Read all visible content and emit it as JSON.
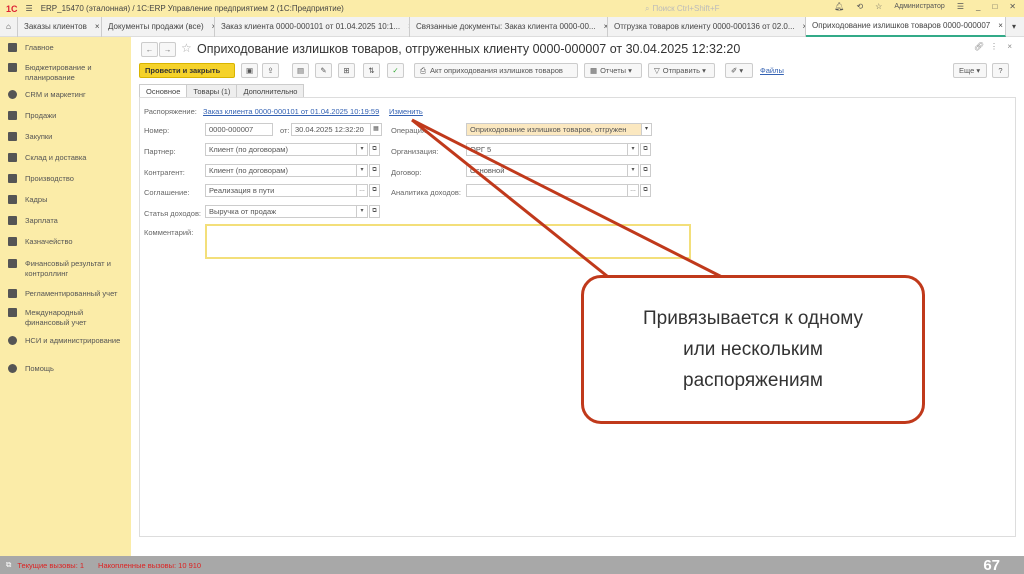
{
  "titlebar": {
    "logo": "1С",
    "title": "ERP_15470 (эталонная) / 1С:ERP Управление предприятием 2  (1С:Предприятие)",
    "search_placeholder": "Поиск Ctrl+Shift+F",
    "user": "Администратор"
  },
  "tabs": [
    {
      "label": "Заказы клиентов"
    },
    {
      "label": "Документы продажи (все)"
    },
    {
      "label": "Заказ клиента 0000-000101 от 01.04.2025 10:1..."
    },
    {
      "label": "Связанные документы: Заказ клиента 0000-00..."
    },
    {
      "label": "Отгрузка товаров клиенту 0000-000136 от 02.0..."
    },
    {
      "label": "Оприходование излишков товаров   0000-000007"
    }
  ],
  "sidebar": {
    "items": [
      {
        "label": "Главное"
      },
      {
        "label": "Бюджетирование и планирование"
      },
      {
        "label": "CRM и маркетинг"
      },
      {
        "label": "Продажи"
      },
      {
        "label": "Закупки"
      },
      {
        "label": "Склад и доставка"
      },
      {
        "label": "Производство"
      },
      {
        "label": "Кадры"
      },
      {
        "label": "Зарплата"
      },
      {
        "label": "Казначейство"
      },
      {
        "label": "Финансовый результат и контроллинг"
      },
      {
        "label": "Регламентированный учет"
      },
      {
        "label": "Международный финансовый учет"
      },
      {
        "label": "НСИ и администрирование"
      },
      {
        "label": "Помощь"
      }
    ]
  },
  "document": {
    "title": "Оприходование излишков товаров, отгруженных клиенту 0000-000007 от 30.04.2025 12:32:20"
  },
  "toolbar": {
    "post_close": "Провести и закрыть",
    "act": "Акт оприходования излишков товаров",
    "reports": "Отчеты",
    "send": "Отправить",
    "files": "Файлы",
    "more": "Еще",
    "help": "?"
  },
  "form_tabs": [
    {
      "label": "Основное"
    },
    {
      "label": "Товары (1)"
    },
    {
      "label": "Дополнительно"
    }
  ],
  "form": {
    "order_label": "Распоряжение:",
    "order_link": "Заказ клиента 0000-000101 от 01.04.2025 10:19:59",
    "change_link": "Изменить",
    "number_label": "Номер:",
    "number": "0000-000007",
    "date_label": "от:",
    "date": "30.04.2025 12:32:20",
    "partner_label": "Партнер:",
    "partner": "Клиент (по договорам)",
    "counterparty_label": "Контрагент:",
    "counterparty": "Клиент (по договорам)",
    "agreement_label": "Соглашение:",
    "agreement": "Реализация в пути",
    "income_item_label": "Статья доходов:",
    "income_item": "Выручка от продаж",
    "comment_label": "Комментарий:",
    "comment": "",
    "operation_label": "Операция:",
    "operation": "Оприходование излишков товаров, отгружен",
    "organization_label": "Организация:",
    "organization": "ОРГ 5",
    "contract_label": "Договор:",
    "contract": "Основной",
    "income_analytics_label": "Аналитика доходов:",
    "income_analytics": ""
  },
  "footer": {
    "current_calls": "Текущие вызовы: 1",
    "accum_calls": "Накопленные вызовы: 10 910"
  },
  "callout": {
    "text": "Привязывается к одному\nили нескольким\nраспоряжениям"
  },
  "slide_number": "67",
  "colors": {
    "accent": "#f5d22a",
    "sidebar": "#fbeca8",
    "callout_border": "#c0391b"
  }
}
